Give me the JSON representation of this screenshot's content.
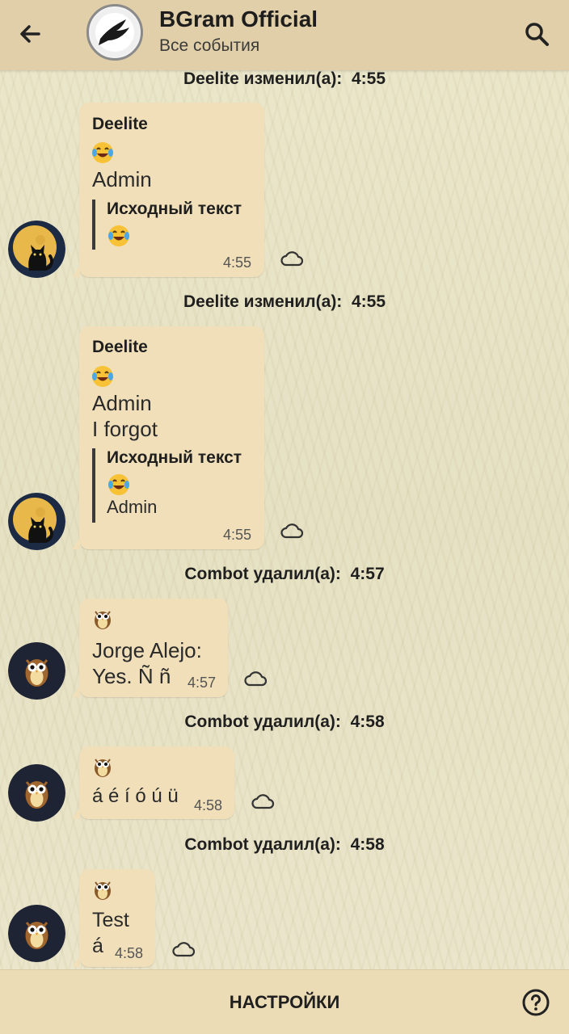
{
  "header": {
    "title": "BGram Official",
    "subtitle": "Все события",
    "back_icon": "arrow-left-icon",
    "search_icon": "search-icon",
    "channel_avatar": "bird-logo"
  },
  "events": [
    {
      "service": {
        "actor": "Deelite изменил(а):",
        "time": "4:55"
      }
    },
    {
      "message": {
        "sender": "Deelite",
        "emoji": "face-with-tears-of-joy",
        "lines": [
          "Admin"
        ],
        "quote_title": "Исходный текст",
        "quote_lines": [],
        "time": "4:55"
      }
    },
    {
      "service": {
        "actor": "Deelite изменил(а):",
        "time": "4:55"
      }
    },
    {
      "message": {
        "sender": "Deelite",
        "emoji": "face-with-tears-of-joy",
        "lines": [
          "Admin",
          "I forgot"
        ],
        "quote_title": "Исходный текст",
        "quote_lines": [
          "Admin"
        ],
        "time": "4:55"
      }
    },
    {
      "service": {
        "actor": "Combot удалил(а):",
        "time": "4:57"
      }
    },
    {
      "message": {
        "emoji": "owl",
        "lines": [
          "Jorge Alejo:",
          "Yes.  Ñ ñ"
        ],
        "time": "4:57"
      }
    },
    {
      "service": {
        "actor": "Combot удалил(а):",
        "time": "4:58"
      }
    },
    {
      "message": {
        "emoji": "owl",
        "lines": [
          "á é í ó ú ü"
        ],
        "time": "4:58"
      }
    },
    {
      "service": {
        "actor": "Combot удалил(а):",
        "time": "4:58"
      }
    },
    {
      "message": {
        "emoji": "owl",
        "lines": [
          "Test",
          "á"
        ],
        "time": "4:58"
      }
    }
  ],
  "bottom": {
    "settings_label": "НАСТРОЙКИ",
    "help_icon": "help-circle-icon"
  },
  "colors": {
    "header_bg": "#e0cfa8",
    "bubble_bg": "#f0dfb9",
    "bottom_bg": "#ecdcb6"
  }
}
